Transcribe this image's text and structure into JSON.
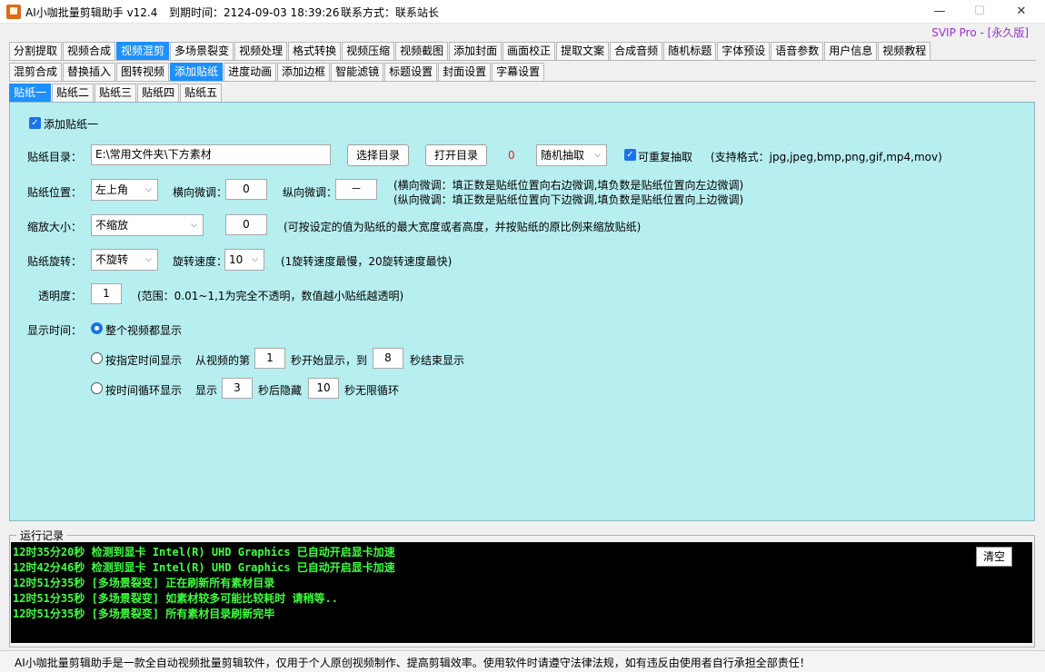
{
  "window": {
    "app_title": "AI小咖批量剪辑助手 v12.4",
    "expiry": "到期时间：2124-09-03 18:39:26",
    "contact": "联系方式：联系站长",
    "minimize": "—",
    "maximize": "☐",
    "close": "✕",
    "svip": "SVIP Pro - [永久版]"
  },
  "tabs_row1": [
    {
      "label": "分割提取"
    },
    {
      "label": "视频合成"
    },
    {
      "label": "视频混剪"
    },
    {
      "label": "多场景裂变"
    },
    {
      "label": "视频处理"
    },
    {
      "label": "格式转换"
    },
    {
      "label": "视频压缩"
    },
    {
      "label": "视频截图"
    },
    {
      "label": "添加封面"
    },
    {
      "label": "画面校正"
    },
    {
      "label": "提取文案"
    },
    {
      "label": "合成音频"
    },
    {
      "label": "随机标题"
    },
    {
      "label": "字体预设"
    },
    {
      "label": "语音参数"
    },
    {
      "label": "用户信息"
    },
    {
      "label": "视频教程"
    }
  ],
  "tabs_row2": [
    {
      "label": "混剪合成"
    },
    {
      "label": "替换插入"
    },
    {
      "label": "图转视频"
    },
    {
      "label": "添加贴纸"
    },
    {
      "label": "进度动画"
    },
    {
      "label": "添加边框"
    },
    {
      "label": "智能滤镜"
    },
    {
      "label": "标题设置"
    },
    {
      "label": "封面设置"
    },
    {
      "label": "字幕设置"
    }
  ],
  "tabs_row3": [
    {
      "label": "贴纸一"
    },
    {
      "label": "贴纸二"
    },
    {
      "label": "贴纸三"
    },
    {
      "label": "贴纸四"
    },
    {
      "label": "贴纸五"
    }
  ],
  "form": {
    "add_sticker": "添加贴纸一",
    "dir_label": "贴纸目录：",
    "dir_value": "E:\\常用文件夹\\下方素材",
    "choose_dir": "选择目录",
    "open_dir": "打开目录",
    "count": "0",
    "pick_mode": "随机抽取",
    "repeat": "可重复抽取",
    "formats": "(支持格式：jpg,jpeg,bmp,png,gif,mp4,mov)",
    "pos_label": "贴纸位置：",
    "pos_value": "左上角",
    "h_adjust_label": "横向微调：",
    "h_adjust_value": "0",
    "v_adjust_label": "纵向微调：",
    "v_adjust_value": "－",
    "h_note": "(横向微调：填正数是贴纸位置向右边微调,填负数是贴纸位置向左边微调)",
    "v_note": "(纵向微调：填正数是贴纸位置向下边微调,填负数是贴纸位置向上边微调)",
    "scale_label": "缩放大小：",
    "scale_value": "不缩放",
    "scale_num": "0",
    "scale_note": "(可按设定的值为贴纸的最大宽度或者高度，并按贴纸的原比例来缩放贴纸)",
    "rotate_label": "贴纸旋转：",
    "rotate_value": "不旋转",
    "speed_label": "旋转速度：",
    "speed_value": "10",
    "speed_note": "(1旋转速度最慢，20旋转速度最快)",
    "opacity_label": "透明度：",
    "opacity_value": "1",
    "opacity_note": "(范围：0.01~1,1为完全不透明，数值越小贴纸越透明)",
    "time_label": "显示时间：",
    "opt_whole": "整个视频都显示",
    "opt_range": "按指定时间显示",
    "range_from": "从视频的第",
    "range_start": "1",
    "range_mid": "秒开始显示，到",
    "range_end": "8",
    "range_tail": "秒结束显示",
    "opt_loop": "按时间循环显示",
    "loop_show": "显示",
    "loop_show_val": "3",
    "loop_hide": "秒后隐藏",
    "loop_hide_val": "10",
    "loop_tail": "秒无限循环"
  },
  "log": {
    "title": "运行记录",
    "clear": "清空",
    "lines": [
      "12时35分20秒 检测到显卡 Intel(R) UHD Graphics 已自动开启显卡加速",
      "12时42分46秒 检测到显卡 Intel(R) UHD Graphics 已自动开启显卡加速",
      "12时51分35秒 [多场景裂变] 正在刷新所有素材目录",
      "12时51分35秒 [多场景裂变] 如素材较多可能比较耗时 请稍等..",
      "12时51分35秒 [多场景裂变] 所有素材目录刷新完毕"
    ]
  },
  "footer": "AI小咖批量剪辑助手是一款全自动视频批量剪辑软件，仅用于个人原创视频制作、提高剪辑效率。使用软件时请遵守法律法规，如有违反由使用者自行承担全部责任！",
  "colors": {
    "accent": "#1e90ff",
    "panel": "#b7eef0",
    "svip": "#9b30d9",
    "log_text": "#3cff3c"
  }
}
